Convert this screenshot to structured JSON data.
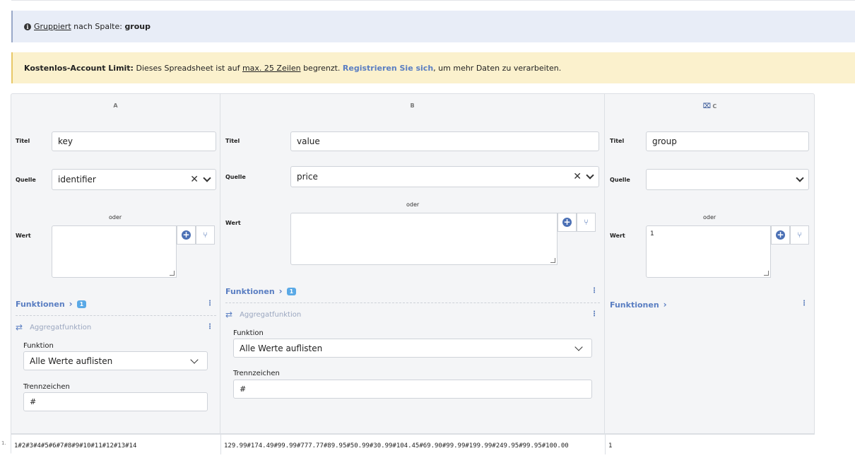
{
  "info": {
    "grouped_link": "Gruppiert",
    "text": "nach Spalte:",
    "column": "group"
  },
  "warning": {
    "bold": "Kostenlos-Account Limit:",
    "text1": "Dieses Spreadsheet ist auf",
    "limit": "max. 25 Zeilen",
    "text2": "begrenzt.",
    "register": "Registrieren Sie sich",
    "text3": ", um mehr Daten zu verarbeiten."
  },
  "labels": {
    "titel": "Titel",
    "quelle": "Quelle",
    "wert": "Wert",
    "oder": "oder",
    "funktionen": "Funktionen",
    "aggregat": "Aggregatfunktion",
    "funktion": "Funktion",
    "trennzeichen": "Trennzeichen"
  },
  "columns": [
    {
      "header": "A",
      "title": "key",
      "source": "identifier",
      "value": "",
      "functions_count": "1",
      "function": "Alle Werte auflisten",
      "separator": "#",
      "output": "1#2#3#4#5#6#7#8#9#10#11#12#13#14"
    },
    {
      "header": "B",
      "title": "value",
      "source": "price",
      "value": "",
      "functions_count": "1",
      "function": "Alle Werte auflisten",
      "separator": "#",
      "output": "129.99#174.49#99.99#777.77#89.95#50.99#30.99#104.45#69.90#99.99#199.99#249.95#99.95#100.00"
    },
    {
      "header": "C",
      "title": "group",
      "source": "",
      "value": "1",
      "output": "1"
    }
  ],
  "row_number": "1."
}
